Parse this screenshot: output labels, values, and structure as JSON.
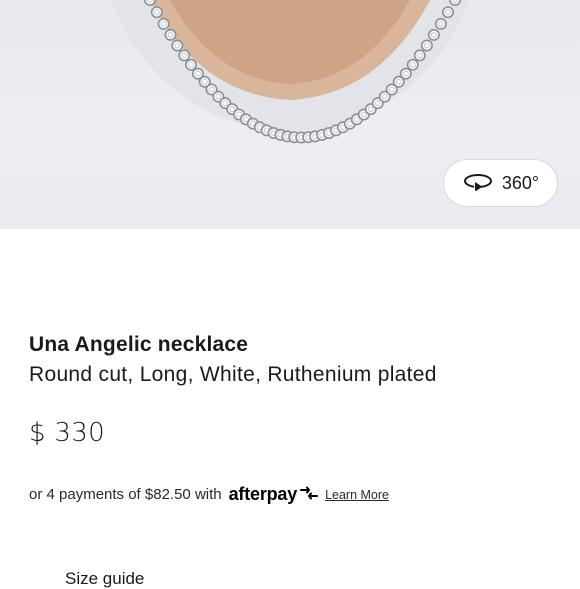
{
  "viewer": {
    "rotate_label": "360°",
    "rotate_icon": "rotate-360-icon"
  },
  "product": {
    "name": "Una Angelic necklace",
    "variant": "Round cut, Long, White, Ruthenium plated",
    "price": "$ 330"
  },
  "payments": {
    "text": "or 4 payments of $82.50 with",
    "brand": "afterpay",
    "learn_more": "Learn More"
  },
  "next_section": {
    "label": "Size guide"
  }
}
